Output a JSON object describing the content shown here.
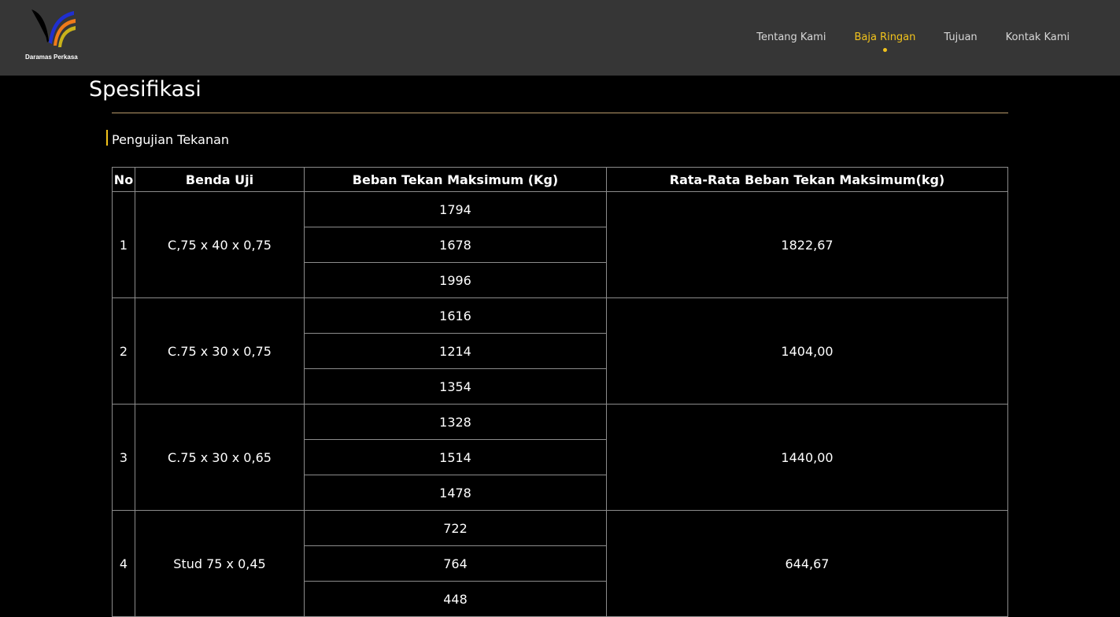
{
  "brand": {
    "name": "Daramas Perkasa",
    "colors": {
      "blue": "#1f2fd0",
      "orange": "#ef7a1a",
      "yellow": "#c9b21a",
      "black": "#000000"
    }
  },
  "nav": {
    "items": [
      {
        "label": "Tentang Kami",
        "active": false
      },
      {
        "label": "Baja Ringan",
        "active": true
      },
      {
        "label": "Tujuan",
        "active": false
      },
      {
        "label": "Kontak Kami",
        "active": false
      }
    ],
    "accent": "#f2c31c"
  },
  "section": {
    "title": "Spesifikasi",
    "subtitle": "Pengujian Tekanan"
  },
  "table": {
    "headers": [
      "No",
      "Benda Uji",
      "Beban Tekan Maksimum (Kg)",
      "Rata-Rata Beban Tekan Maksimum(kg)"
    ],
    "rows": [
      {
        "no": "1",
        "benda": "C,75 x 40 x 0,75",
        "beban": [
          "1794",
          "1678",
          "1996"
        ],
        "rata": "1822,67"
      },
      {
        "no": "2",
        "benda": "C.75 x 30 x 0,75",
        "beban": [
          "1616",
          "1214",
          "1354"
        ],
        "rata": "1404,00"
      },
      {
        "no": "3",
        "benda": "C.75 x 30 x 0,65",
        "beban": [
          "1328",
          "1514",
          "1478"
        ],
        "rata": "1440,00"
      },
      {
        "no": "4",
        "benda": "Stud 75 x 0,45",
        "beban": [
          "722",
          "764",
          "448"
        ],
        "rata": "644,67"
      }
    ]
  }
}
